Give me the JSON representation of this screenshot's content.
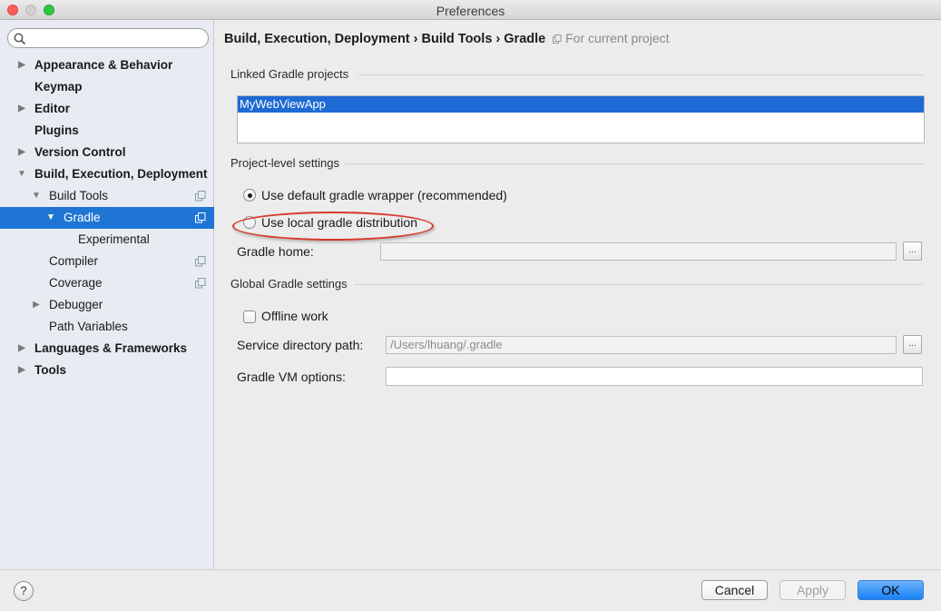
{
  "window": {
    "title": "Preferences"
  },
  "search": {
    "placeholder": ""
  },
  "sidebar": {
    "items": [
      {
        "label": "Appearance & Behavior",
        "has_arrow": true,
        "expanded": false,
        "bold": true
      },
      {
        "label": "Keymap",
        "has_arrow": false,
        "bold": true
      },
      {
        "label": "Editor",
        "has_arrow": true,
        "expanded": false,
        "bold": true
      },
      {
        "label": "Plugins",
        "has_arrow": false,
        "bold": true
      },
      {
        "label": "Version Control",
        "has_arrow": true,
        "expanded": false,
        "bold": true
      },
      {
        "label": "Build, Execution, Deployment",
        "has_arrow": true,
        "expanded": true,
        "bold": true
      },
      {
        "label": "Build Tools",
        "has_arrow": true,
        "expanded": true,
        "bold": false,
        "project_icon": true
      },
      {
        "label": "Gradle",
        "has_arrow": true,
        "expanded": true,
        "bold": false,
        "project_icon": true,
        "selected": true
      },
      {
        "label": "Experimental",
        "has_arrow": false,
        "bold": false
      },
      {
        "label": "Compiler",
        "has_arrow": false,
        "bold": false,
        "project_icon": true
      },
      {
        "label": "Coverage",
        "has_arrow": false,
        "bold": false,
        "project_icon": true
      },
      {
        "label": "Debugger",
        "has_arrow": true,
        "expanded": false,
        "bold": false
      },
      {
        "label": "Path Variables",
        "has_arrow": false,
        "bold": false
      },
      {
        "label": "Languages & Frameworks",
        "has_arrow": true,
        "expanded": false,
        "bold": true
      },
      {
        "label": "Tools",
        "has_arrow": true,
        "expanded": false,
        "bold": true
      }
    ]
  },
  "breadcrumb": {
    "path": "Build, Execution, Deployment › Build Tools › Gradle",
    "scope": "For current project"
  },
  "linked_projects": {
    "title": "Linked Gradle projects",
    "items": [
      "MyWebViewApp"
    ],
    "selected": "MyWebViewApp"
  },
  "project_settings": {
    "title": "Project-level settings",
    "option_default": "Use default gradle wrapper (recommended)",
    "option_local": "Use local gradle distribution",
    "selected_option": "default",
    "gradle_home_label": "Gradle home:",
    "gradle_home_value": "",
    "browse_label": "..."
  },
  "global_settings": {
    "title": "Global Gradle settings",
    "offline_work_label": "Offline work",
    "offline_work_checked": false,
    "service_dir_label": "Service directory path:",
    "service_dir_value": "/Users/lhuang/.gradle",
    "vm_options_label": "Gradle VM options:",
    "vm_options_value": "",
    "browse_label": "..."
  },
  "footer": {
    "help_label": "?",
    "cancel_label": "Cancel",
    "apply_label": "Apply",
    "ok_label": "OK"
  },
  "colors": {
    "selection": "#1e75d4",
    "highlight_ellipse": "#d8382b",
    "sidebar_bg": "#e8ecf2"
  }
}
